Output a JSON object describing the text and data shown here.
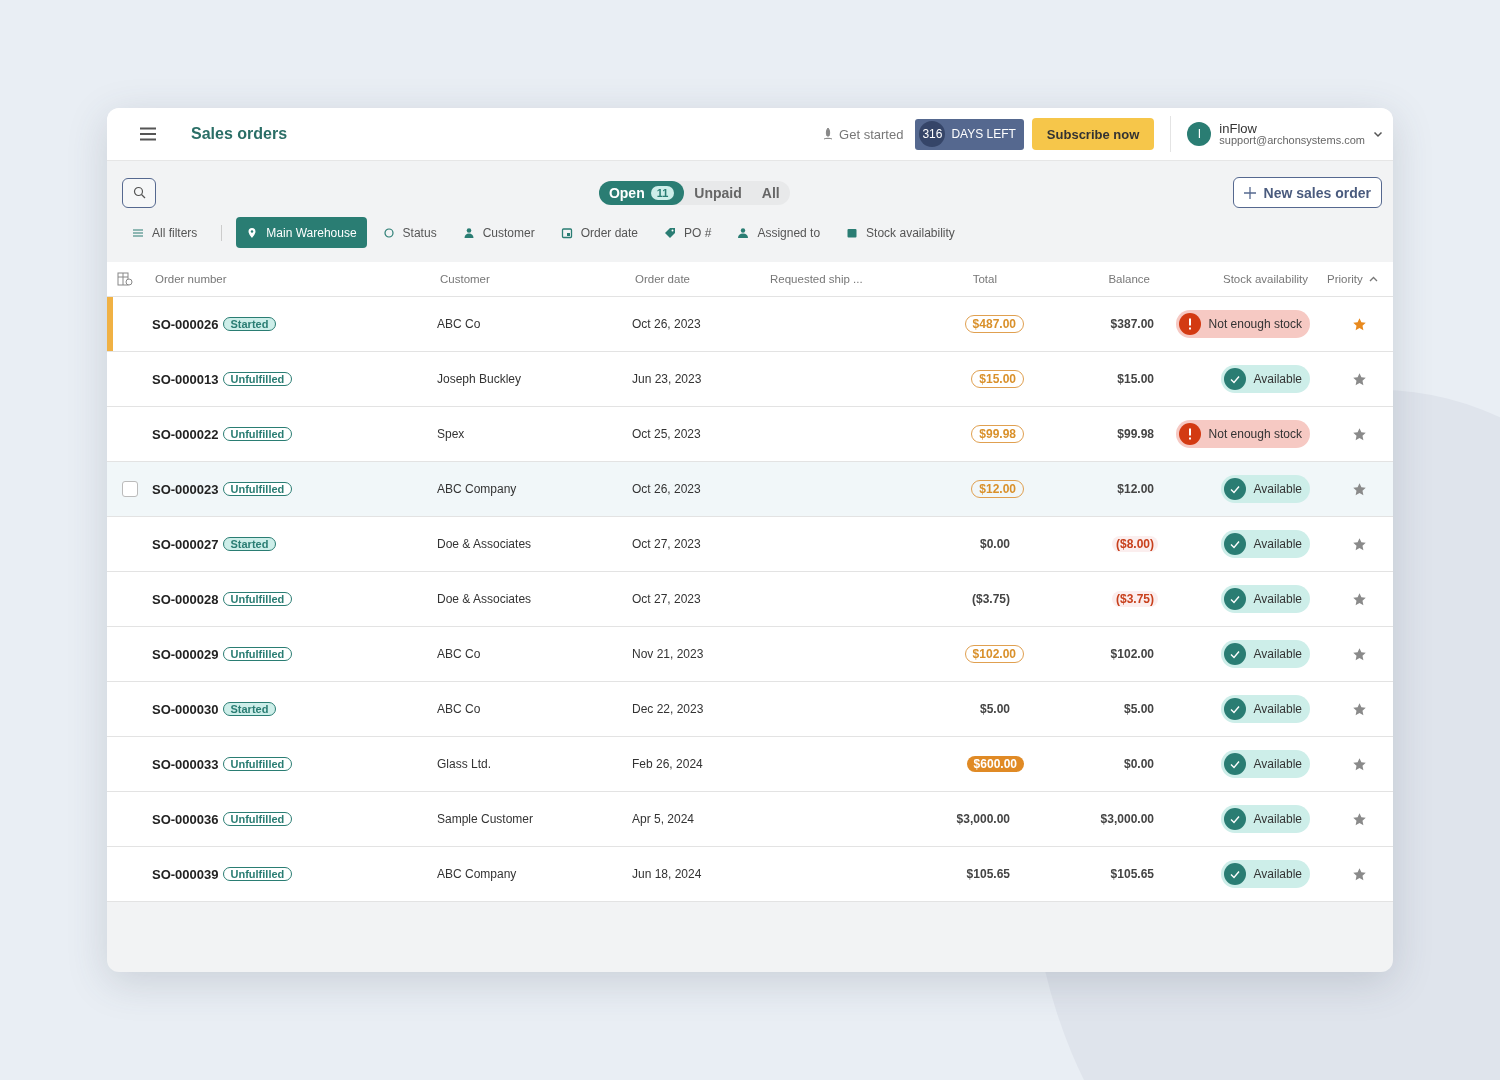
{
  "header": {
    "title": "Sales orders",
    "get_started": "Get started",
    "days_count": "316",
    "days_label": "DAYS LEFT",
    "subscribe": "Subscribe now",
    "account_initial": "I",
    "account_name": "inFlow",
    "account_email": "support@archonsystems.com"
  },
  "tabs": [
    {
      "label": "Open",
      "count": "11",
      "selected": true
    },
    {
      "label": "Unpaid",
      "selected": false
    },
    {
      "label": "All",
      "selected": false
    }
  ],
  "new_button": "New sales order",
  "filters": [
    {
      "kind": "all",
      "label": "All filters",
      "selected": false
    },
    {
      "kind": "location",
      "label": "Main Warehouse",
      "selected": true
    },
    {
      "kind": "status",
      "label": "Status",
      "selected": false
    },
    {
      "kind": "customer",
      "label": "Customer",
      "selected": false
    },
    {
      "kind": "date",
      "label": "Order date",
      "selected": false
    },
    {
      "kind": "po",
      "label": "PO #",
      "selected": false
    },
    {
      "kind": "assignee",
      "label": "Assigned to",
      "selected": false
    },
    {
      "kind": "stock",
      "label": "Stock availability",
      "selected": false
    }
  ],
  "table": {
    "columns": [
      "Order number",
      "Customer",
      "Order date",
      "Requested ship ...",
      "Total",
      "Balance",
      "Stock availability",
      "Priority"
    ],
    "rows": [
      {
        "order": "SO-000026",
        "status": {
          "label": "Started",
          "kind": "started"
        },
        "customer": "ABC Co",
        "date": "Oct 26, 2023",
        "total": {
          "value": "$487.00",
          "kind": "outline"
        },
        "balance": {
          "value": "$387.00",
          "kind": "plain"
        },
        "stock": {
          "label": "Not enough stock",
          "kind": "short"
        },
        "starred": true,
        "selected": true,
        "hovered": false
      },
      {
        "order": "SO-000013",
        "status": {
          "label": "Unfulfilled",
          "kind": "unfulfilled"
        },
        "customer": "Joseph Buckley",
        "date": "Jun 23, 2023",
        "total": {
          "value": "$15.00",
          "kind": "outline"
        },
        "balance": {
          "value": "$15.00",
          "kind": "plain"
        },
        "stock": {
          "label": "Available",
          "kind": "available"
        },
        "starred": false,
        "selected": false,
        "hovered": false
      },
      {
        "order": "SO-000022",
        "status": {
          "label": "Unfulfilled",
          "kind": "unfulfilled"
        },
        "customer": "Spex",
        "date": "Oct 25, 2023",
        "total": {
          "value": "$99.98",
          "kind": "outline"
        },
        "balance": {
          "value": "$99.98",
          "kind": "plain"
        },
        "stock": {
          "label": "Not enough stock",
          "kind": "short"
        },
        "starred": false,
        "selected": false,
        "hovered": false
      },
      {
        "order": "SO-000023",
        "status": {
          "label": "Unfulfilled",
          "kind": "unfulfilled"
        },
        "customer": "ABC Company",
        "date": "Oct 26, 2023",
        "total": {
          "value": "$12.00",
          "kind": "outline"
        },
        "balance": {
          "value": "$12.00",
          "kind": "plain"
        },
        "stock": {
          "label": "Available",
          "kind": "available"
        },
        "starred": false,
        "selected": false,
        "hovered": true
      },
      {
        "order": "SO-000027",
        "status": {
          "label": "Started",
          "kind": "started"
        },
        "customer": "Doe & Associates",
        "date": "Oct 27, 2023",
        "total": {
          "value": "$0.00",
          "kind": "plain"
        },
        "balance": {
          "value": "($8.00)",
          "kind": "negative"
        },
        "stock": {
          "label": "Available",
          "kind": "available"
        },
        "starred": false,
        "selected": false,
        "hovered": false
      },
      {
        "order": "SO-000028",
        "status": {
          "label": "Unfulfilled",
          "kind": "unfulfilled"
        },
        "customer": "Doe & Associates",
        "date": "Oct 27, 2023",
        "total": {
          "value": "($3.75)",
          "kind": "plain"
        },
        "balance": {
          "value": "($3.75)",
          "kind": "negative"
        },
        "stock": {
          "label": "Available",
          "kind": "available"
        },
        "starred": false,
        "selected": false,
        "hovered": false
      },
      {
        "order": "SO-000029",
        "status": {
          "label": "Unfulfilled",
          "kind": "unfulfilled"
        },
        "customer": "ABC Co",
        "date": "Nov 21, 2023",
        "total": {
          "value": "$102.00",
          "kind": "outline"
        },
        "balance": {
          "value": "$102.00",
          "kind": "plain"
        },
        "stock": {
          "label": "Available",
          "kind": "available"
        },
        "starred": false,
        "selected": false,
        "hovered": false
      },
      {
        "order": "SO-000030",
        "status": {
          "label": "Started",
          "kind": "started"
        },
        "customer": "ABC Co",
        "date": "Dec 22, 2023",
        "total": {
          "value": "$5.00",
          "kind": "plain"
        },
        "balance": {
          "value": "$5.00",
          "kind": "plain"
        },
        "stock": {
          "label": "Available",
          "kind": "available"
        },
        "starred": false,
        "selected": false,
        "hovered": false
      },
      {
        "order": "SO-000033",
        "status": {
          "label": "Unfulfilled",
          "kind": "unfulfilled"
        },
        "customer": "Glass Ltd.",
        "date": "Feb 26, 2024",
        "total": {
          "value": "$600.00",
          "kind": "filled"
        },
        "balance": {
          "value": "$0.00",
          "kind": "plain"
        },
        "stock": {
          "label": "Available",
          "kind": "available"
        },
        "starred": false,
        "selected": false,
        "hovered": false
      },
      {
        "order": "SO-000036",
        "status": {
          "label": "Unfulfilled",
          "kind": "unfulfilled"
        },
        "customer": "Sample Customer",
        "date": "Apr 5, 2024",
        "total": {
          "value": "$3,000.00",
          "kind": "plain"
        },
        "balance": {
          "value": "$3,000.00",
          "kind": "plain"
        },
        "stock": {
          "label": "Available",
          "kind": "available"
        },
        "starred": false,
        "selected": false,
        "hovered": false
      },
      {
        "order": "SO-000039",
        "status": {
          "label": "Unfulfilled",
          "kind": "unfulfilled"
        },
        "customer": "ABC Company",
        "date": "Jun 18, 2024",
        "total": {
          "value": "$105.65",
          "kind": "plain"
        },
        "balance": {
          "value": "$105.65",
          "kind": "plain"
        },
        "stock": {
          "label": "Available",
          "kind": "available"
        },
        "starred": false,
        "selected": false,
        "hovered": false
      }
    ]
  }
}
